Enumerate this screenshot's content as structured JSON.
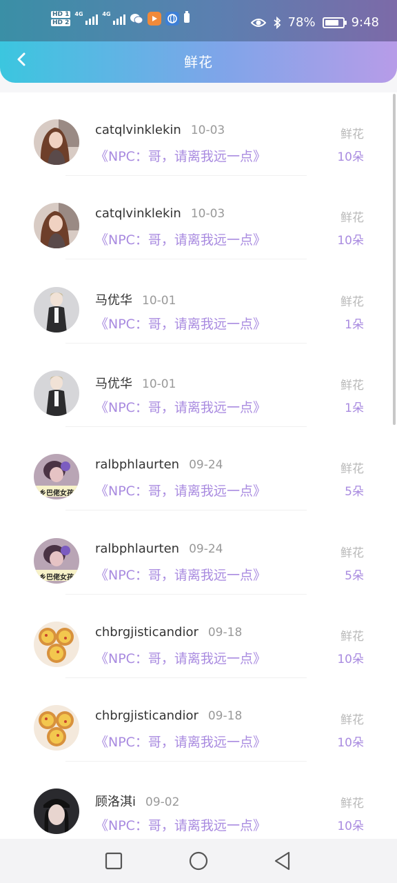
{
  "status_bar": {
    "hd1": "HD 1",
    "hd2": "HD 2",
    "net1": "4G",
    "net2": "4G",
    "battery_text": "78%",
    "battery_level": 0.78,
    "time": "9:48"
  },
  "header": {
    "title": "鲜花"
  },
  "records": [
    {
      "name": "catqlvinklekin",
      "date": "10-03",
      "work": "《NPC：哥，请离我远一点》",
      "gift_type": "鲜花",
      "count": "10朵",
      "avatar": "girl-brown-hair"
    },
    {
      "name": "catqlvinklekin",
      "date": "10-03",
      "work": "《NPC：哥，请离我远一点》",
      "gift_type": "鲜花",
      "count": "10朵",
      "avatar": "girl-brown-hair"
    },
    {
      "name": "马优华",
      "date": "10-01",
      "work": "《NPC：哥，请离我远一点》",
      "gift_type": "鲜花",
      "count": "1朵",
      "avatar": "anime-boy"
    },
    {
      "name": "马优华",
      "date": "10-01",
      "work": "《NPC：哥，请离我远一点》",
      "gift_type": "鲜花",
      "count": "1朵",
      "avatar": "anime-boy"
    },
    {
      "name": "ralbphlaurten",
      "date": "09-24",
      "work": "《NPC：哥，请离我远一点》",
      "gift_type": "鲜花",
      "count": "5朵",
      "avatar": "meme-girl",
      "avatar_text": "乡巴佬女孩"
    },
    {
      "name": "ralbphlaurten",
      "date": "09-24",
      "work": "《NPC：哥，请离我远一点》",
      "gift_type": "鲜花",
      "count": "5朵",
      "avatar": "meme-girl",
      "avatar_text": "乡巴佬女孩"
    },
    {
      "name": "chbrgjisticandior",
      "date": "09-18",
      "work": "《NPC：哥，请离我远一点》",
      "gift_type": "鲜花",
      "count": "10朵",
      "avatar": "egg-tarts"
    },
    {
      "name": "chbrgjisticandior",
      "date": "09-18",
      "work": "《NPC：哥，请离我远一点》",
      "gift_type": "鲜花",
      "count": "10朵",
      "avatar": "egg-tarts"
    },
    {
      "name": "顾洛淇i",
      "date": "09-02",
      "work": "《NPC：哥，请离我远一点》",
      "gift_type": "鲜花",
      "count": "10朵",
      "avatar": "girl-black-cap"
    }
  ],
  "nav": {
    "recent": "square-icon",
    "home": "circle-icon",
    "back": "triangle-back-icon"
  },
  "colors": {
    "accent": "#a98be0",
    "header_start": "#3bc6df",
    "header_end": "#b79ce8"
  }
}
